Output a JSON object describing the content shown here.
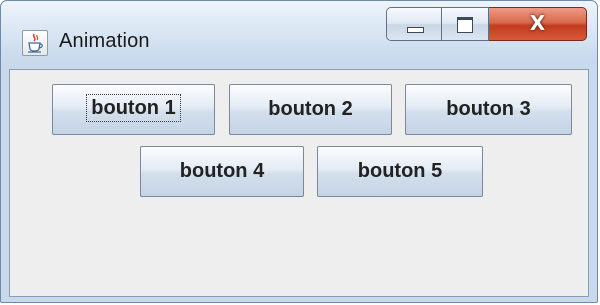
{
  "window": {
    "title": "Animation",
    "icon": "java-coffee-cup-icon",
    "controls": {
      "minimize_icon": "minimize-icon",
      "maximize_icon": "maximize-icon",
      "close_label": "X"
    }
  },
  "buttons": [
    {
      "label": "bouton 1",
      "focused": true
    },
    {
      "label": "bouton 2",
      "focused": false
    },
    {
      "label": "bouton 3",
      "focused": false
    },
    {
      "label": "bouton 4",
      "focused": false
    },
    {
      "label": "bouton 5",
      "focused": false
    }
  ],
  "colors": {
    "close_button": "#c9452a",
    "client_background": "#eeeeee",
    "frame": "#c8d9ec"
  }
}
